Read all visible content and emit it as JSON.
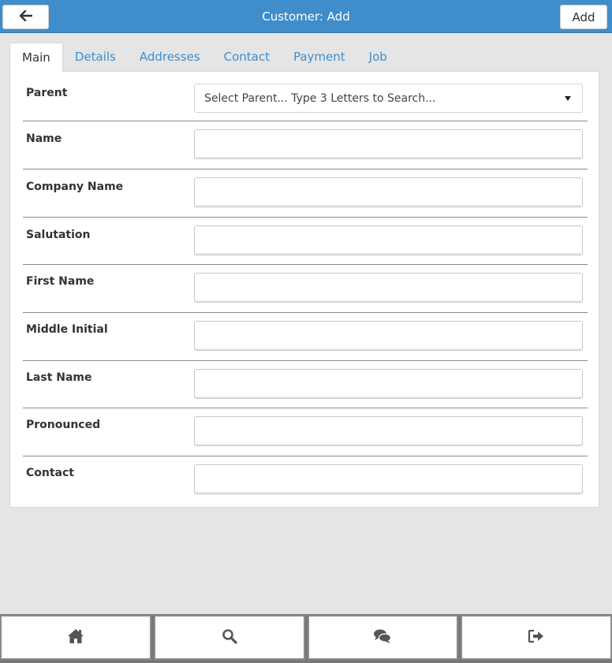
{
  "header": {
    "title": "Customer: Add",
    "back_icon": "arrow-left-icon",
    "add_label": "Add",
    "bg_color": "#3f8dcb"
  },
  "tabs": [
    {
      "label": "Main",
      "active": true
    },
    {
      "label": "Details",
      "active": false
    },
    {
      "label": "Addresses",
      "active": false
    },
    {
      "label": "Contact",
      "active": false
    },
    {
      "label": "Payment",
      "active": false
    },
    {
      "label": "Job",
      "active": false
    }
  ],
  "form": {
    "parent": {
      "label": "Parent",
      "value": "Select Parent... Type 3 Letters to Search..."
    },
    "name": {
      "label": "Name",
      "value": ""
    },
    "company_name": {
      "label": "Company Name",
      "value": ""
    },
    "salutation": {
      "label": "Salutation",
      "value": ""
    },
    "first_name": {
      "label": "First Name",
      "value": ""
    },
    "middle_initial": {
      "label": "Middle Initial",
      "value": ""
    },
    "last_name": {
      "label": "Last Name",
      "value": ""
    },
    "pronounced": {
      "label": "Pronounced",
      "value": ""
    },
    "contact": {
      "label": "Contact",
      "value": ""
    }
  },
  "bottom_nav": [
    {
      "icon": "home-icon"
    },
    {
      "icon": "search-icon"
    },
    {
      "icon": "chat-icon"
    },
    {
      "icon": "logout-icon"
    }
  ]
}
